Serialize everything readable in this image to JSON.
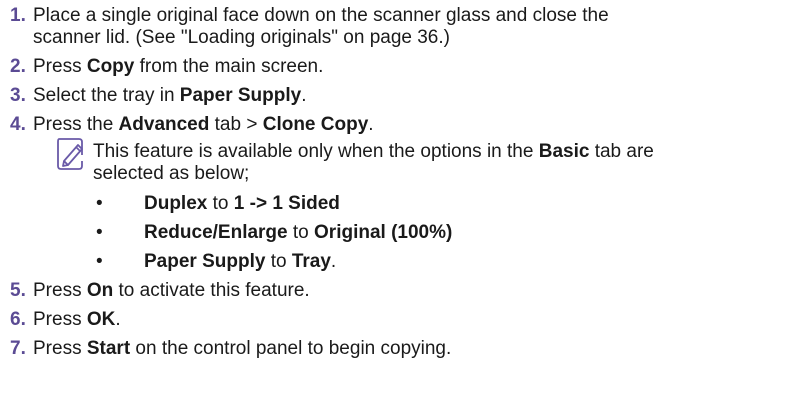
{
  "steps": [
    {
      "number": "1.",
      "line1": "Place a single original face down on the scanner glass and close the",
      "line2": "scanner lid. (See \"Loading originals\" on page 36.)"
    },
    {
      "number": "2.",
      "pre": "Press ",
      "bold": "Copy",
      "post": " from the main screen."
    },
    {
      "number": "3.",
      "pre": "Select the tray in ",
      "bold": "Paper Supply",
      "post": "."
    },
    {
      "number": "4.",
      "pre": "Press the ",
      "bold1": "Advanced",
      "mid": " tab > ",
      "bold2": "Clone Copy",
      "post": "."
    },
    {
      "number": "5.",
      "pre": "Press ",
      "bold": "On",
      "post": " to activate this feature."
    },
    {
      "number": "6.",
      "pre": "Press ",
      "bold": "OK",
      "post": "."
    },
    {
      "number": "7.",
      "pre": "Press ",
      "bold": "Start",
      "post": " on the control panel to begin copying."
    }
  ],
  "note": {
    "icon": "note-pencil-icon",
    "pre": "This feature is available only when the options in the ",
    "bold": "Basic",
    "post": " tab are",
    "line2": "selected as below;",
    "bullet_char": "•",
    "bullets": [
      {
        "bold1": "Duplex",
        "mid": " to ",
        "bold2": "1 -> 1 Sided",
        "post": ""
      },
      {
        "bold1": "Reduce/Enlarge",
        "mid": " to ",
        "bold2": "Original (100%)",
        "post": ""
      },
      {
        "bold1": "Paper Supply",
        "mid": " to ",
        "bold2": "Tray",
        "post": "."
      }
    ]
  },
  "colors": {
    "step_number": "#5b4b94",
    "icon": "#6a5aa8",
    "text": "#1a1a1a"
  }
}
